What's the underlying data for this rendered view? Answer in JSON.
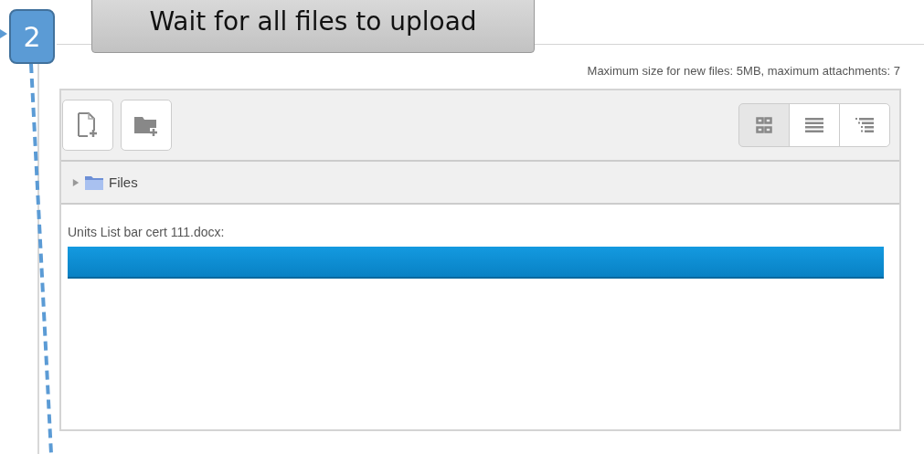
{
  "callout": {
    "number": "2",
    "banner": "Wait for all files to upload"
  },
  "limits": "Maximum size for new files: 5MB, maximum attachments: 7",
  "view_buttons": [
    {
      "kind": "icons",
      "selected": true
    },
    {
      "kind": "list",
      "selected": false
    },
    {
      "kind": "tree",
      "selected": false
    }
  ],
  "breadcrumb": {
    "label": "Files",
    "expanded": false
  },
  "upload": {
    "filename": "Units List bar cert 111.docx:",
    "level": 1
  }
}
